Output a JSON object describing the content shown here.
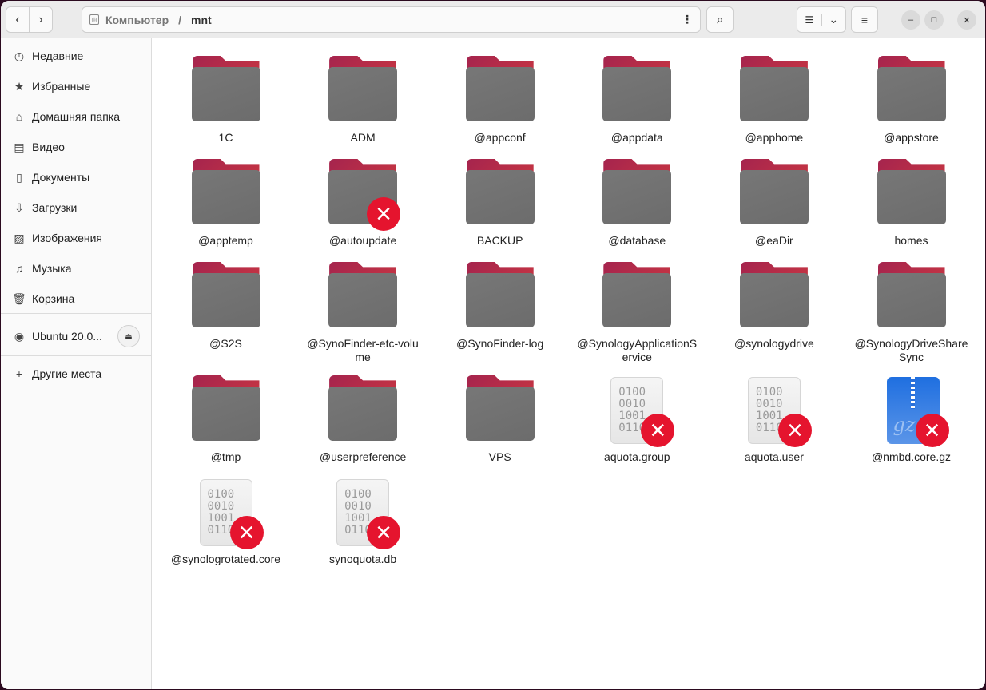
{
  "nav": {
    "back": "‹",
    "forward": "›"
  },
  "path": {
    "root": "Компьютер",
    "separator": "/",
    "current": "mnt"
  },
  "toolbar": {
    "menu": "⋮",
    "search": "⌕",
    "view_list": "☰",
    "view_dropdown": "⌄",
    "hamburger": "≡",
    "minimize": "–",
    "maximize": "□",
    "close": "✕"
  },
  "sidebar": {
    "items": [
      {
        "icon": "clock-icon",
        "glyph": "◷",
        "label": "Недавние"
      },
      {
        "icon": "star-icon",
        "glyph": "★",
        "label": "Избранные"
      },
      {
        "icon": "home-icon",
        "glyph": "⌂",
        "label": "Домашняя папка"
      },
      {
        "icon": "video-icon",
        "glyph": "▤",
        "label": "Видео"
      },
      {
        "icon": "document-icon",
        "glyph": "▯",
        "label": "Документы"
      },
      {
        "icon": "download-icon",
        "glyph": "⇩",
        "label": "Загрузки"
      },
      {
        "icon": "image-icon",
        "glyph": "▨",
        "label": "Изображения"
      },
      {
        "icon": "music-icon",
        "glyph": "♫",
        "label": "Музыка"
      },
      {
        "icon": "trash-icon",
        "glyph": "🗑",
        "label": "Корзина"
      }
    ],
    "drive": {
      "label": "Ubuntu 20.0...",
      "glyph": "◉",
      "eject": "⏏"
    },
    "other": {
      "label": "Другие места",
      "glyph": "+"
    }
  },
  "files": [
    {
      "name": "1C",
      "type": "folder"
    },
    {
      "name": "ADM",
      "type": "folder"
    },
    {
      "name": "@appconf",
      "type": "folder"
    },
    {
      "name": "@appdata",
      "type": "folder"
    },
    {
      "name": "@apphome",
      "type": "folder"
    },
    {
      "name": "@appstore",
      "type": "folder"
    },
    {
      "name": "@apptemp",
      "type": "folder"
    },
    {
      "name": "@autoupdate",
      "type": "folder",
      "error": true
    },
    {
      "name": "BACKUP",
      "type": "folder"
    },
    {
      "name": "@database",
      "type": "folder"
    },
    {
      "name": "@eaDir",
      "type": "folder"
    },
    {
      "name": "homes",
      "type": "folder"
    },
    {
      "name": "@S2S",
      "type": "folder"
    },
    {
      "name": "@SynoFinder-etc-volume",
      "type": "folder"
    },
    {
      "name": "@SynoFinder-log",
      "type": "folder"
    },
    {
      "name": "@SynologyApplicationService",
      "type": "folder"
    },
    {
      "name": "@synologydrive",
      "type": "folder"
    },
    {
      "name": "@SynologyDriveShareSync",
      "type": "folder"
    },
    {
      "name": "@tmp",
      "type": "folder"
    },
    {
      "name": "@userpreference",
      "type": "folder"
    },
    {
      "name": "VPS",
      "type": "folder"
    },
    {
      "name": "aquota.group",
      "type": "binary",
      "error": true
    },
    {
      "name": "aquota.user",
      "type": "binary",
      "error": true
    },
    {
      "name": "@nmbd.core.gz",
      "type": "gz",
      "error": true
    },
    {
      "name": "@synologrotated.core",
      "type": "binary",
      "error": true
    },
    {
      "name": "synoquota.db",
      "type": "binary",
      "error": true
    }
  ],
  "icon_text": {
    "binary": "0100\n0010\n1001\n0110",
    "gz": "gz",
    "error": "×"
  }
}
